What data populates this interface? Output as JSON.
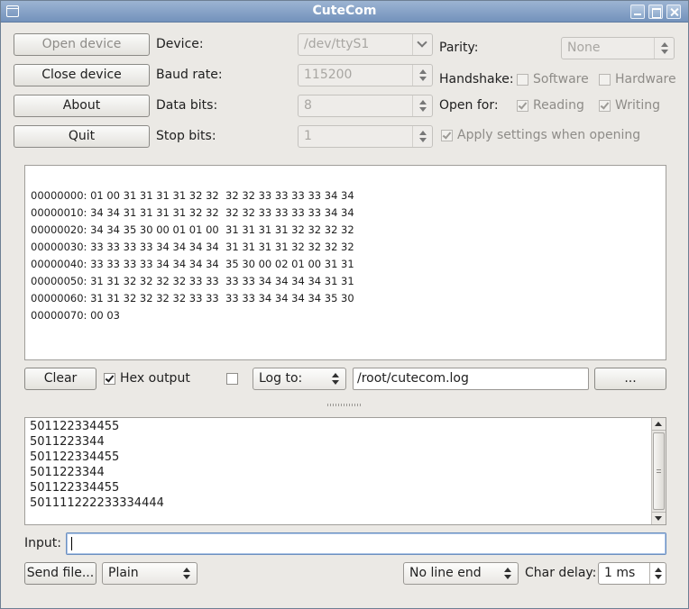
{
  "window": {
    "title": "CuteCom"
  },
  "buttons": {
    "open_device": "Open device",
    "close_device": "Close device",
    "about": "About",
    "quit": "Quit"
  },
  "settings": {
    "device": {
      "label": "Device:",
      "value": "/dev/ttyS1"
    },
    "baud_rate": {
      "label": "Baud rate:",
      "value": "115200"
    },
    "data_bits": {
      "label": "Data bits:",
      "value": "8"
    },
    "stop_bits": {
      "label": "Stop bits:",
      "value": "1"
    },
    "parity": {
      "label": "Parity:",
      "value": "None"
    },
    "handshake": {
      "label": "Handshake:",
      "software": "Software",
      "hardware": "Hardware"
    },
    "open_for": {
      "label": "Open for:",
      "reading": "Reading",
      "writing": "Writing"
    },
    "apply_settings": "Apply settings when opening"
  },
  "output": {
    "lines": [
      "00000000: 01 00 31 31 31 31 32 32  32 32 33 33 33 33 34 34",
      "00000010: 34 34 31 31 31 31 32 32  32 32 33 33 33 33 34 34",
      "00000020: 34 34 35 30 00 01 01 00  31 31 31 31 32 32 32 32",
      "00000030: 33 33 33 33 34 34 34 34  31 31 31 31 32 32 32 32",
      "00000040: 33 33 33 33 34 34 34 34  35 30 00 02 01 00 31 31",
      "00000050: 31 31 32 32 32 32 33 33  33 33 34 34 34 34 31 31",
      "00000060: 31 31 32 32 32 32 33 33  33 33 34 34 34 34 35 30",
      "00000070: 00 03"
    ]
  },
  "output_controls": {
    "clear": "Clear",
    "hex_output": "Hex output",
    "log_to": "Log to:",
    "log_path": "/root/cutecom.log",
    "browse": "..."
  },
  "history": [
    "501122334455",
    "5011223344",
    "501122334455",
    "5011223344",
    "501122334455",
    "501111222233334444"
  ],
  "input": {
    "label": "Input:",
    "value": ""
  },
  "bottom": {
    "send_file": "Send file...",
    "format": "Plain",
    "line_end": "No line end",
    "char_delay_label": "Char delay:",
    "char_delay": "1 ms"
  }
}
